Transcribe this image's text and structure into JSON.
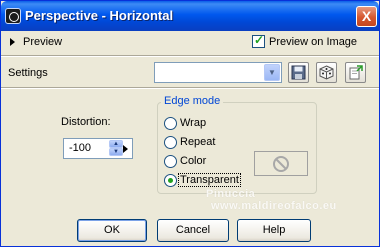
{
  "window": {
    "title": "Perspective - Horizontal",
    "close": "X"
  },
  "preview": {
    "toggle_label": "Preview",
    "preview_on_image_label": "Preview on Image",
    "preview_on_image_checked": true,
    "check_glyph": "✓"
  },
  "settings": {
    "label": "Settings",
    "selected_value": "",
    "arrow_glyph": "▼"
  },
  "toolbar": {
    "icons": [
      "save-preset-icon",
      "randomize-icon",
      "reset-icon"
    ]
  },
  "distortion": {
    "label": "Distortion:",
    "value": "-100",
    "up_glyph": "▲",
    "down_glyph": "▼"
  },
  "edge_mode": {
    "title": "Edge mode",
    "options": [
      {
        "label": "Wrap",
        "selected": false
      },
      {
        "label": "Repeat",
        "selected": false
      },
      {
        "label": "Color",
        "selected": false
      },
      {
        "label": "Transparent",
        "selected": true
      }
    ]
  },
  "watermark": {
    "line1": "Pinuccia",
    "line2": "www.maldireofalco.eu"
  },
  "buttons": {
    "ok": "OK",
    "cancel": "Cancel",
    "help": "Help"
  },
  "colors": {
    "title_bar": "#0058ee",
    "face": "#ece9d8",
    "group_title": "#0046d5",
    "radio_dot": "#21a121"
  }
}
